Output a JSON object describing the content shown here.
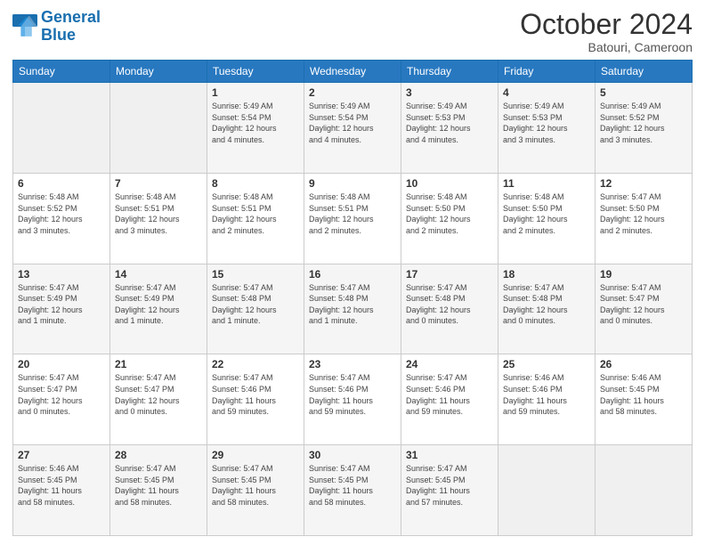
{
  "logo": {
    "line1": "General",
    "line2": "Blue"
  },
  "header": {
    "month": "October 2024",
    "location": "Batouri, Cameroon"
  },
  "weekdays": [
    "Sunday",
    "Monday",
    "Tuesday",
    "Wednesday",
    "Thursday",
    "Friday",
    "Saturday"
  ],
  "weeks": [
    [
      {
        "day": "",
        "info": ""
      },
      {
        "day": "",
        "info": ""
      },
      {
        "day": "1",
        "info": "Sunrise: 5:49 AM\nSunset: 5:54 PM\nDaylight: 12 hours\nand 4 minutes."
      },
      {
        "day": "2",
        "info": "Sunrise: 5:49 AM\nSunset: 5:54 PM\nDaylight: 12 hours\nand 4 minutes."
      },
      {
        "day": "3",
        "info": "Sunrise: 5:49 AM\nSunset: 5:53 PM\nDaylight: 12 hours\nand 4 minutes."
      },
      {
        "day": "4",
        "info": "Sunrise: 5:49 AM\nSunset: 5:53 PM\nDaylight: 12 hours\nand 3 minutes."
      },
      {
        "day": "5",
        "info": "Sunrise: 5:49 AM\nSunset: 5:52 PM\nDaylight: 12 hours\nand 3 minutes."
      }
    ],
    [
      {
        "day": "6",
        "info": "Sunrise: 5:48 AM\nSunset: 5:52 PM\nDaylight: 12 hours\nand 3 minutes."
      },
      {
        "day": "7",
        "info": "Sunrise: 5:48 AM\nSunset: 5:51 PM\nDaylight: 12 hours\nand 3 minutes."
      },
      {
        "day": "8",
        "info": "Sunrise: 5:48 AM\nSunset: 5:51 PM\nDaylight: 12 hours\nand 2 minutes."
      },
      {
        "day": "9",
        "info": "Sunrise: 5:48 AM\nSunset: 5:51 PM\nDaylight: 12 hours\nand 2 minutes."
      },
      {
        "day": "10",
        "info": "Sunrise: 5:48 AM\nSunset: 5:50 PM\nDaylight: 12 hours\nand 2 minutes."
      },
      {
        "day": "11",
        "info": "Sunrise: 5:48 AM\nSunset: 5:50 PM\nDaylight: 12 hours\nand 2 minutes."
      },
      {
        "day": "12",
        "info": "Sunrise: 5:47 AM\nSunset: 5:50 PM\nDaylight: 12 hours\nand 2 minutes."
      }
    ],
    [
      {
        "day": "13",
        "info": "Sunrise: 5:47 AM\nSunset: 5:49 PM\nDaylight: 12 hours\nand 1 minute."
      },
      {
        "day": "14",
        "info": "Sunrise: 5:47 AM\nSunset: 5:49 PM\nDaylight: 12 hours\nand 1 minute."
      },
      {
        "day": "15",
        "info": "Sunrise: 5:47 AM\nSunset: 5:48 PM\nDaylight: 12 hours\nand 1 minute."
      },
      {
        "day": "16",
        "info": "Sunrise: 5:47 AM\nSunset: 5:48 PM\nDaylight: 12 hours\nand 1 minute."
      },
      {
        "day": "17",
        "info": "Sunrise: 5:47 AM\nSunset: 5:48 PM\nDaylight: 12 hours\nand 0 minutes."
      },
      {
        "day": "18",
        "info": "Sunrise: 5:47 AM\nSunset: 5:48 PM\nDaylight: 12 hours\nand 0 minutes."
      },
      {
        "day": "19",
        "info": "Sunrise: 5:47 AM\nSunset: 5:47 PM\nDaylight: 12 hours\nand 0 minutes."
      }
    ],
    [
      {
        "day": "20",
        "info": "Sunrise: 5:47 AM\nSunset: 5:47 PM\nDaylight: 12 hours\nand 0 minutes."
      },
      {
        "day": "21",
        "info": "Sunrise: 5:47 AM\nSunset: 5:47 PM\nDaylight: 12 hours\nand 0 minutes."
      },
      {
        "day": "22",
        "info": "Sunrise: 5:47 AM\nSunset: 5:46 PM\nDaylight: 11 hours\nand 59 minutes."
      },
      {
        "day": "23",
        "info": "Sunrise: 5:47 AM\nSunset: 5:46 PM\nDaylight: 11 hours\nand 59 minutes."
      },
      {
        "day": "24",
        "info": "Sunrise: 5:47 AM\nSunset: 5:46 PM\nDaylight: 11 hours\nand 59 minutes."
      },
      {
        "day": "25",
        "info": "Sunrise: 5:46 AM\nSunset: 5:46 PM\nDaylight: 11 hours\nand 59 minutes."
      },
      {
        "day": "26",
        "info": "Sunrise: 5:46 AM\nSunset: 5:45 PM\nDaylight: 11 hours\nand 58 minutes."
      }
    ],
    [
      {
        "day": "27",
        "info": "Sunrise: 5:46 AM\nSunset: 5:45 PM\nDaylight: 11 hours\nand 58 minutes."
      },
      {
        "day": "28",
        "info": "Sunrise: 5:47 AM\nSunset: 5:45 PM\nDaylight: 11 hours\nand 58 minutes."
      },
      {
        "day": "29",
        "info": "Sunrise: 5:47 AM\nSunset: 5:45 PM\nDaylight: 11 hours\nand 58 minutes."
      },
      {
        "day": "30",
        "info": "Sunrise: 5:47 AM\nSunset: 5:45 PM\nDaylight: 11 hours\nand 58 minutes."
      },
      {
        "day": "31",
        "info": "Sunrise: 5:47 AM\nSunset: 5:45 PM\nDaylight: 11 hours\nand 57 minutes."
      },
      {
        "day": "",
        "info": ""
      },
      {
        "day": "",
        "info": ""
      }
    ]
  ]
}
